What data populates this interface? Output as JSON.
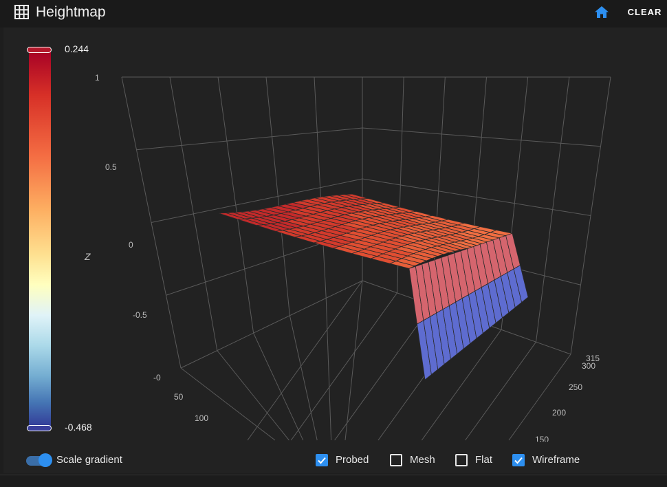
{
  "header": {
    "title": "Heightmap",
    "clear_label": "CLEAR",
    "icons": {
      "grid": "grid-icon",
      "home": "home-icon"
    }
  },
  "legend": {
    "max_label": "0.244",
    "min_label": "-0.468"
  },
  "chart_data": {
    "type": "surface-3d",
    "zlabel": "Z",
    "z_ticks": [
      "1",
      "0.5",
      "0",
      "-0.5",
      "-0"
    ],
    "x_ticks": [
      "50",
      "100"
    ],
    "y_ticks": [
      "315",
      "300",
      "250",
      "200",
      "150"
    ],
    "zlim": [
      -1,
      1
    ],
    "color_range": [
      -0.468,
      0.244
    ],
    "colorscale": [
      "#a50026",
      "#d73027",
      "#f46d43",
      "#fdae61",
      "#fee090",
      "#ffffbf",
      "#e0f3f8",
      "#abd9e9",
      "#74add1",
      "#4575b4",
      "#313695"
    ]
  },
  "options": {
    "scale_gradient": {
      "label": "Scale gradient",
      "on": true
    },
    "probed": {
      "label": "Probed",
      "checked": true
    },
    "mesh": {
      "label": "Mesh",
      "checked": false
    },
    "flat": {
      "label": "Flat",
      "checked": false
    },
    "wireframe": {
      "label": "Wireframe",
      "checked": true
    }
  },
  "colors": {
    "accent": "#2d8ff0",
    "background": "#222222",
    "header": "#1a1a1a"
  }
}
